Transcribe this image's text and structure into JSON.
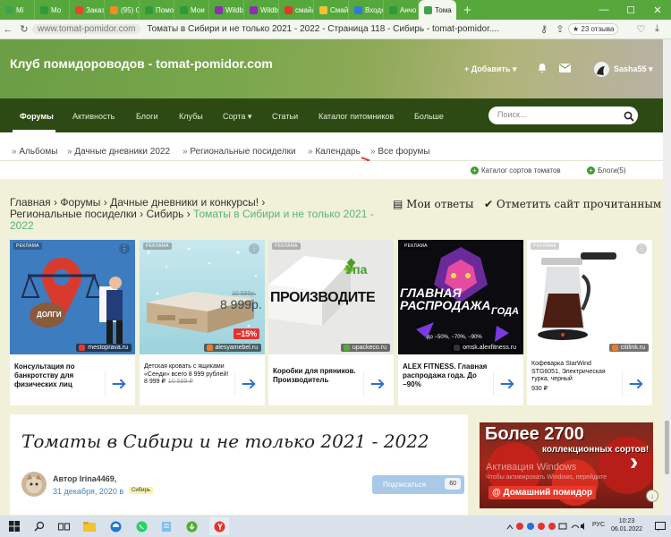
{
  "browser": {
    "tabs": [
      {
        "label": "Mi",
        "color": "#3fa34d"
      },
      {
        "label": "Мо",
        "color": "#2f9a3a"
      },
      {
        "label": "Заказ",
        "color": "#e04a2a"
      },
      {
        "label": "(95) О",
        "color": "#f08a2a"
      },
      {
        "label": "Помо",
        "color": "#2f9a3a"
      },
      {
        "label": "Мои",
        "color": "#2f9a3a"
      },
      {
        "label": "Wildb",
        "color": "#8a2fb0"
      },
      {
        "label": "Wildb",
        "color": "#8a2fb0"
      },
      {
        "label": "смайл",
        "color": "#e03a2a"
      },
      {
        "label": "Смайл",
        "color": "#f2c230"
      },
      {
        "label": "Входя",
        "color": "#2f7ad9"
      },
      {
        "label": "Анчо",
        "color": "#2f9a3a"
      },
      {
        "label": "Тома",
        "color": "#3fa34d",
        "active": true
      }
    ],
    "new_tab": "+",
    "window_controls": [
      "—",
      "☐",
      "✕"
    ],
    "url_domain": "www.tomat-pomidor.com",
    "page_title": "Томаты в Сибири и не только 2021 - 2022 - Страница 118 - Сибирь - tomat-pomidor....",
    "reviews_badge": "★ 23 отзыва"
  },
  "header": {
    "site_title": "Клуб помидороводов - tomat-pomidor.com",
    "add_button": "+ Добавить ▾",
    "username": "Sasha55 ▾"
  },
  "mainnav": {
    "items": [
      "Форумы",
      "Активность",
      "Блоги",
      "Клубы",
      "Сорта ▾",
      "Статьи",
      "Каталог питомников",
      "Больше"
    ],
    "search_placeholder": "Поиск..."
  },
  "subnav": {
    "items": [
      "Альбомы",
      "Дачные дневники 2022",
      "Региональные посиделки",
      "Календарь",
      "Все форумы"
    ],
    "catalog_link": "Каталог сортов томатов",
    "blogs_link": "Блоги(5)"
  },
  "breadcrumb": {
    "parts": [
      "Главная",
      "Форумы",
      "Дачные дневники и конкурсы!",
      "Региональные посиделки",
      "Сибирь"
    ],
    "current": "Томаты в Сибири и не только 2021 - 2022",
    "my_replies": "Мои ответы",
    "mark_read": "Отметить сайт прочитанным"
  },
  "ads": [
    {
      "tag": "РЕКЛАМА",
      "site": "mestoprava.ru",
      "text": "Консультация по банкротству для физических лиц",
      "img_text": "ДОЛГИ",
      "site_color": "#e53b2c"
    },
    {
      "tag": "РЕКЛАМА",
      "site": "alesyamebel.ru",
      "text": "Детская кровать с ящиками «Сенди» всего 8 999 рублей!",
      "price": "8 999 ₽",
      "old_price": "10 599 ₽",
      "img_price": "8 999р.",
      "img_old": "10 599р.",
      "discount": "−15%",
      "site_color": "#f07a2a"
    },
    {
      "tag": "РЕКЛАМА",
      "site": "upackeco.ru",
      "text": "Коробки для пряников. Производитель",
      "img_text": "ПРОИЗВОДИТЕ",
      "brand": "Упа",
      "site_color": "#5aa83a"
    },
    {
      "tag": "РЕКЛАМА",
      "site": "omsk.alexfitness.ru",
      "text": "ALEX FITNESS. Главная распродажа года. До −90%",
      "img_line1": "ГЛАВНАЯ",
      "img_line2": "РАСПРОДАЖА",
      "img_line3": "ГОДА",
      "img_badges": [
        "до −50%",
        "−70%",
        "−90%"
      ],
      "site_color": "#333333"
    },
    {
      "tag": "РЕКЛАМА",
      "site": "citilink.ru",
      "text": "Кофеварка StarWind STG6051, Электрическая турка, черный",
      "price": "930 ₽",
      "site_color": "#f07a2a"
    }
  ],
  "topic": {
    "title": "Томаты в Сибири и не только 2021 - 2022",
    "author": "Автор Irina4469,",
    "date": "31 декабря, 2020 в",
    "tag": "Сибирь",
    "subscribe_label": "Подписаться",
    "subscribe_count": "60"
  },
  "banner": {
    "head": "Более 2700",
    "sub": "коллекционных сортов!",
    "brand": "@ Домашний помидор",
    "watermark": "Активация Windows",
    "watermark_sub": "Чтобы активировать Windows, перейдите"
  },
  "taskbar": {
    "lang": "РУС",
    "time": "10:23",
    "date": "06.01.2022"
  }
}
